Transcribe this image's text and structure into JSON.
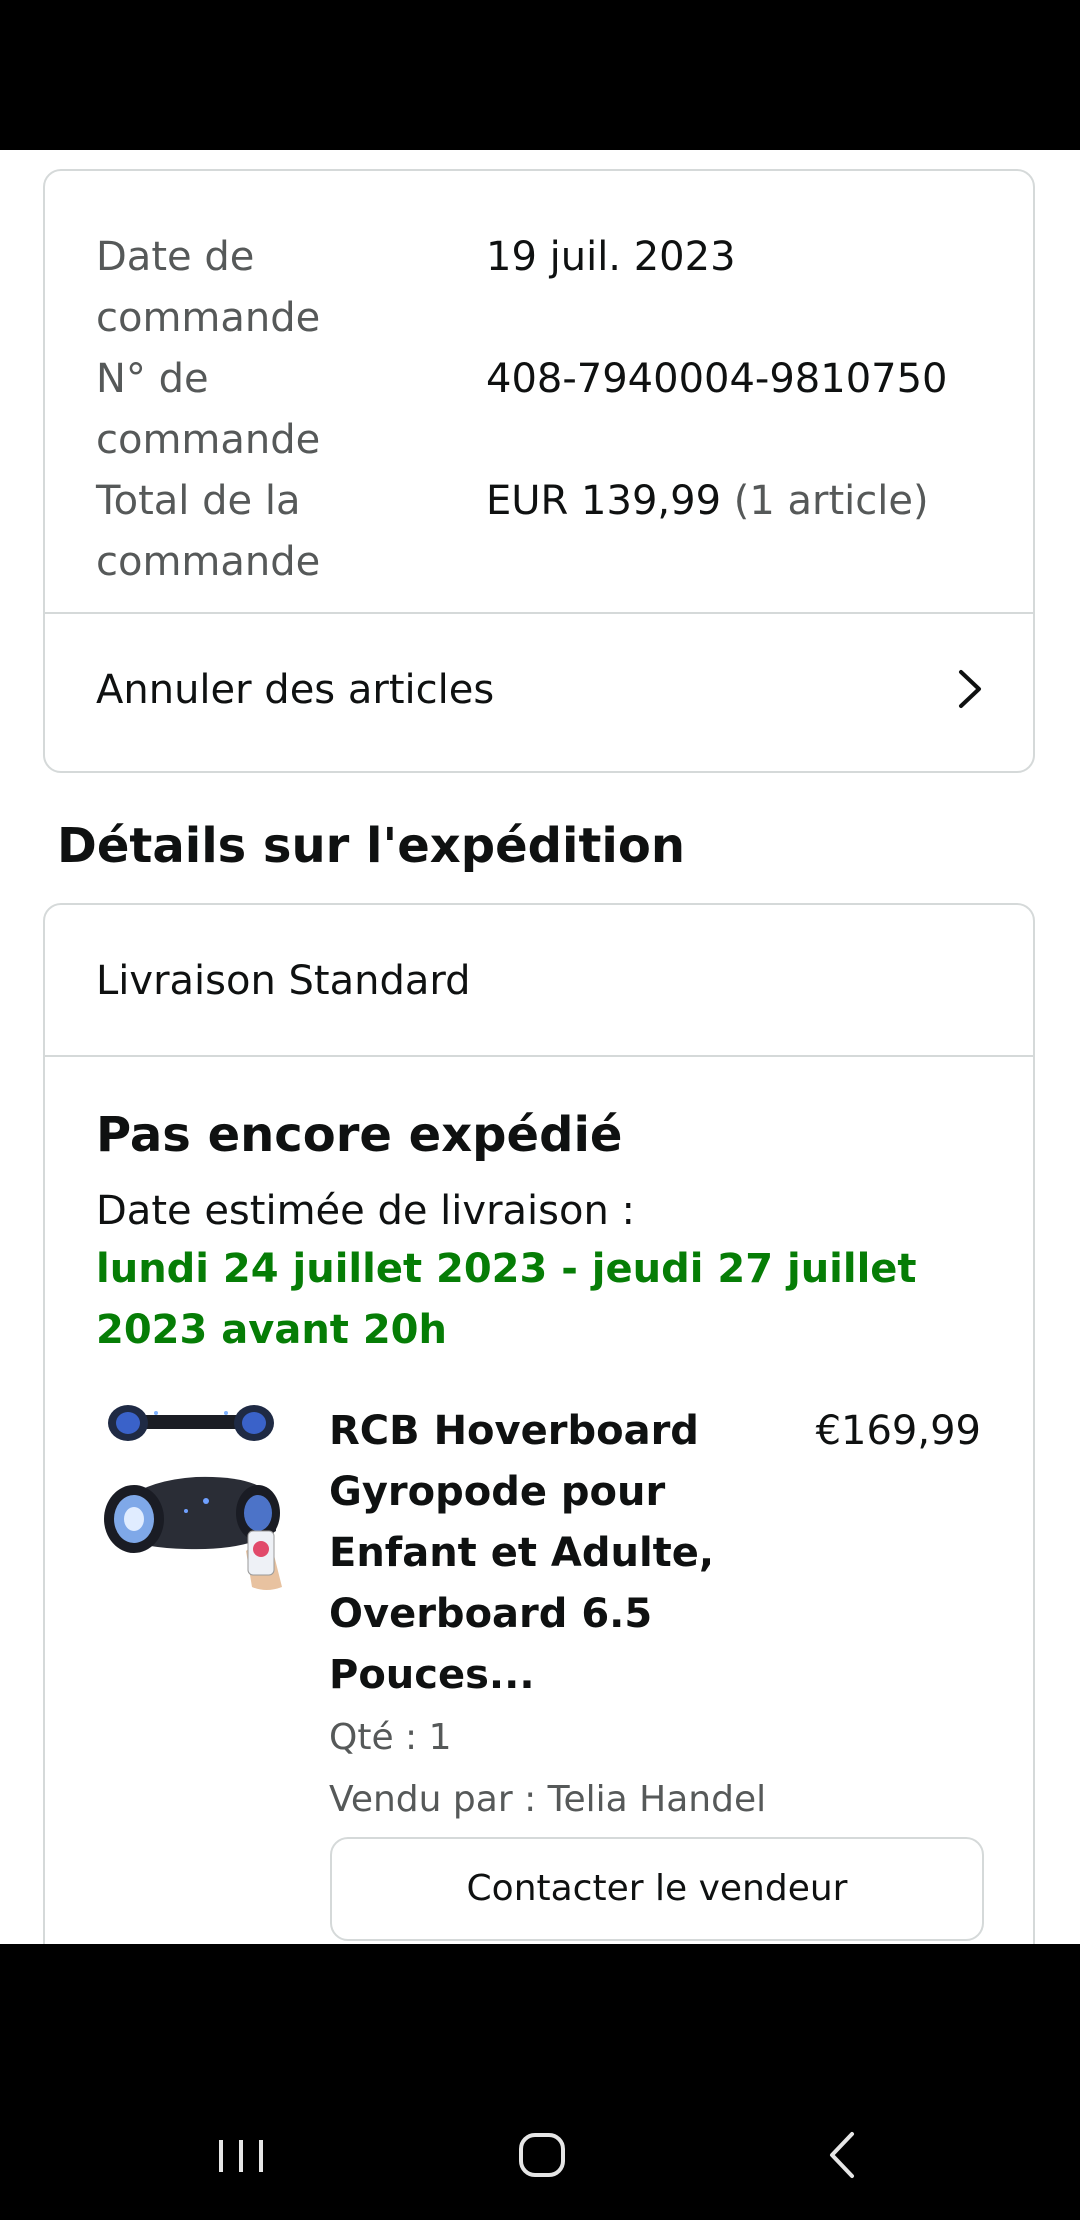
{
  "order_summary": {
    "rows": [
      {
        "label": "Date de commande",
        "value": "19 juil. 2023"
      },
      {
        "label": "N° de commande",
        "value": "408-7940004-9810750"
      },
      {
        "label": "Total de la commande",
        "value": "EUR 139,99",
        "extra": "(1 article)"
      }
    ],
    "cancel_label": "Annuler des articles",
    "cancel_icon": "chevron-right-icon"
  },
  "shipping": {
    "section_title": "Détails sur l'expédition",
    "method": "Livraison Standard",
    "status": "Pas encore expédié",
    "estimate_label": "Date estimée de livraison :",
    "estimate_date": "lundi 24 juillet 2023 - jeudi 27 juillet 2023 avant 20h",
    "estimate_color": "#067d06"
  },
  "item": {
    "title": "RCB Hoverboard Gyropode pour Enfant et Adulte, Overboard 6.5 Pouces...",
    "price": "€169,99",
    "qty": "Qté : 1",
    "seller": "Vendu par : Telia Handel",
    "contact_label": "Contacter le vendeur",
    "image": "hoverboard-product-image"
  },
  "nav": {
    "recents": "recents-icon",
    "home": "home-icon",
    "back": "back-icon"
  }
}
